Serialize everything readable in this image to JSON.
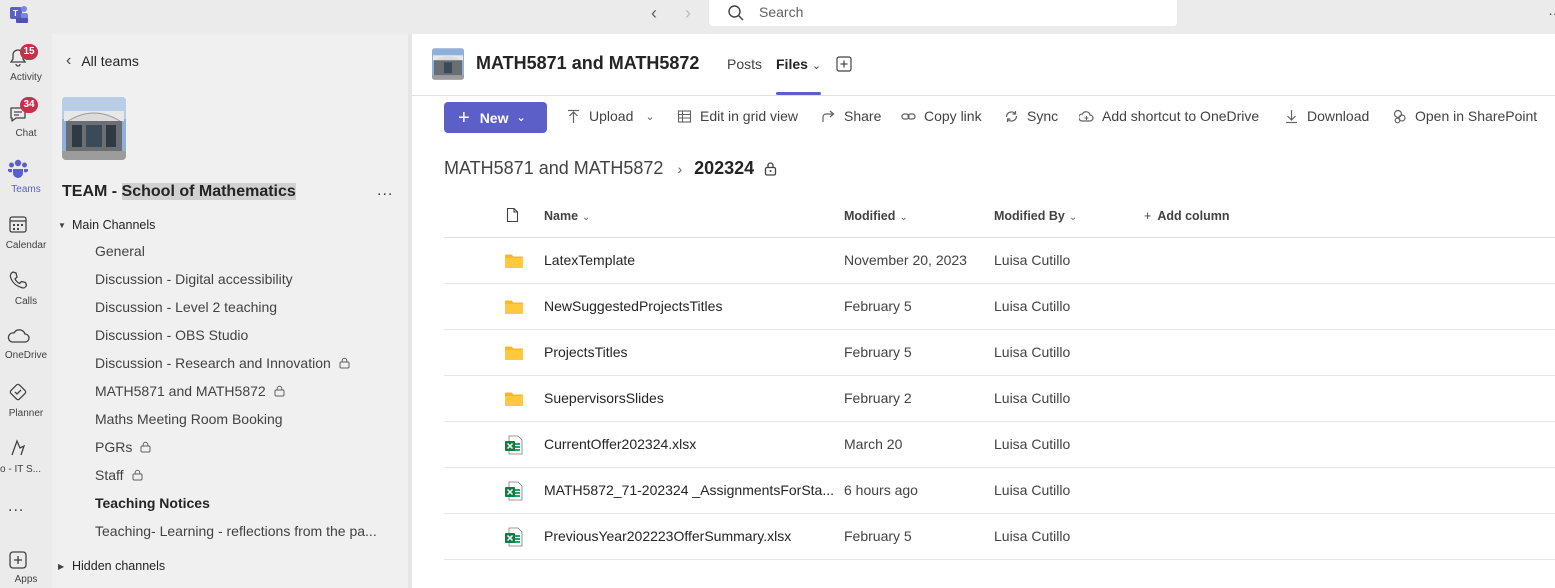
{
  "titlebar": {
    "search_placeholder": "Search",
    "back_icon": "chevron-left-icon",
    "forward_icon": "chevron-right-icon"
  },
  "rail": {
    "items": [
      {
        "label": "Activity",
        "icon": "bell-icon",
        "badge": "15"
      },
      {
        "label": "Chat",
        "icon": "chat-icon",
        "badge": "34"
      },
      {
        "label": "Teams",
        "icon": "teams-icon",
        "badge": ""
      },
      {
        "label": "Calendar",
        "icon": "calendar-icon",
        "badge": ""
      },
      {
        "label": "Calls",
        "icon": "phone-icon",
        "badge": ""
      },
      {
        "label": "OneDrive",
        "icon": "cloud-icon",
        "badge": ""
      },
      {
        "label": "Planner",
        "icon": "planner-icon",
        "badge": ""
      },
      {
        "label": "co - IT S...",
        "icon": "app-icon",
        "badge": ""
      },
      {
        "label": "Apps",
        "icon": "apps-icon",
        "badge": ""
      }
    ],
    "more": "..."
  },
  "team_pane": {
    "back_label": "All teams",
    "team_prefix": "TEAM - ",
    "team_name": "School of Mathematics",
    "more": "...",
    "main_channels_label": "Main Channels",
    "hidden_channels_label": "Hidden channels",
    "channels": [
      {
        "label": "General",
        "locked": false,
        "bold": false
      },
      {
        "label": "Discussion - Digital accessibility",
        "locked": false,
        "bold": false
      },
      {
        "label": "Discussion - Level 2 teaching",
        "locked": false,
        "bold": false
      },
      {
        "label": "Discussion - OBS Studio",
        "locked": false,
        "bold": false
      },
      {
        "label": "Discussion - Research and Innovation",
        "locked": true,
        "bold": false
      },
      {
        "label": "MATH5871 and MATH5872",
        "locked": true,
        "bold": false
      },
      {
        "label": "Maths Meeting Room Booking",
        "locked": false,
        "bold": false
      },
      {
        "label": "PGRs",
        "locked": true,
        "bold": false
      },
      {
        "label": "Staff",
        "locked": true,
        "bold": false
      },
      {
        "label": "Teaching Notices",
        "locked": false,
        "bold": true
      },
      {
        "label": "Teaching- Learning - reflections from the pa...",
        "locked": false,
        "bold": false
      }
    ]
  },
  "main": {
    "title": "MATH5871 and MATH5872",
    "tabs": [
      {
        "label": "Posts"
      },
      {
        "label": "Files"
      }
    ],
    "toolbar": {
      "new": "New",
      "upload": "Upload",
      "edit_grid": "Edit in grid view",
      "share": "Share",
      "copy_link": "Copy link",
      "sync": "Sync",
      "add_shortcut": "Add shortcut to OneDrive",
      "download": "Download",
      "open_sharepoint": "Open in SharePoint"
    },
    "breadcrumb": {
      "parent": "MATH5871 and MATH5872",
      "current": "202324"
    },
    "columns": {
      "name": "Name",
      "modified": "Modified",
      "modified_by": "Modified By",
      "add_column": "Add column"
    },
    "files": [
      {
        "type": "folder",
        "name": "LatexTemplate",
        "modified": "November 20, 2023",
        "modified_by": "Luisa Cutillo"
      },
      {
        "type": "folder",
        "name": "NewSuggestedProjectsTitles",
        "modified": "February 5",
        "modified_by": "Luisa Cutillo"
      },
      {
        "type": "folder",
        "name": "ProjectsTitles",
        "modified": "February 5",
        "modified_by": "Luisa Cutillo"
      },
      {
        "type": "folder",
        "name": "SuepervisorsSlides",
        "modified": "February 2",
        "modified_by": "Luisa Cutillo"
      },
      {
        "type": "excel",
        "name": "CurrentOffer202324.xlsx",
        "modified": "March 20",
        "modified_by": "Luisa Cutillo"
      },
      {
        "type": "excel",
        "name": "MATH5872_71-202324 _AssignmentsForSta...",
        "modified": "6 hours ago",
        "modified_by": "Luisa Cutillo"
      },
      {
        "type": "excel",
        "name": "PreviousYear202223OfferSummary.xlsx",
        "modified": "February 5",
        "modified_by": "Luisa Cutillo"
      }
    ]
  },
  "colors": {
    "accent": "#5b5fc7",
    "badge": "#c4314b",
    "folder": "#f5b829",
    "excel": "#107c41"
  }
}
